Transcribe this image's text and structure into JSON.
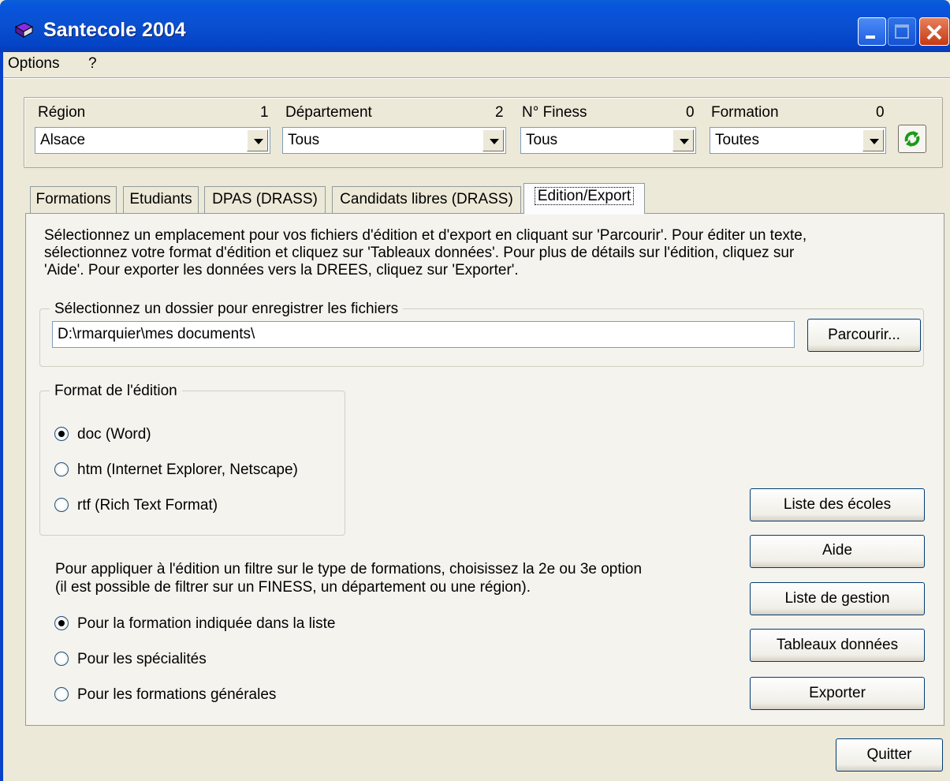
{
  "window": {
    "title": "Santecole 2004"
  },
  "menu": {
    "items": [
      "Options",
      "?"
    ]
  },
  "filters": {
    "region": {
      "label": "Région",
      "count": "1",
      "value": "Alsace"
    },
    "departement": {
      "label": "Département",
      "count": "2",
      "value": "Tous"
    },
    "finess": {
      "label": "N° Finess",
      "count": "0",
      "value": "Tous"
    },
    "formation": {
      "label": "Formation",
      "count": "0",
      "value": "Toutes"
    }
  },
  "tabs": [
    {
      "label": "Formations"
    },
    {
      "label": "Etudiants"
    },
    {
      "label": "DPAS (DRASS)"
    },
    {
      "label": "Candidats libres (DRASS)"
    },
    {
      "label": "Edition/Export"
    }
  ],
  "edition": {
    "description": [
      "Sélectionnez un emplacement pour vos fichiers d'édition et d'export en cliquant sur 'Parcourir'. Pour éditer un texte,",
      "sélectionnez votre format d'édition et cliquez sur 'Tableaux données'. Pour plus de détails sur l'édition, cliquez sur",
      "'Aide'. Pour exporter les données vers la DREES, cliquez sur 'Exporter'."
    ],
    "folder_group_label": "Sélectionnez un dossier pour enregistrer les fichiers",
    "folder_path": "D:\\rmarquier\\mes documents\\",
    "browse_label": "Parcourir...",
    "format_group_label": "Format de l'édition",
    "formats": [
      {
        "label": "doc (Word)",
        "checked": true
      },
      {
        "label": "htm (Internet Explorer, Netscape)",
        "checked": false
      },
      {
        "label": "rtf (Rich Text Format)",
        "checked": false
      }
    ],
    "filter_text": [
      "Pour appliquer à l'édition un filtre sur le type de formations, choisissez la 2e ou 3e option",
      "(il est possible de filtrer sur un FINESS, un département ou une région)."
    ],
    "filter_options": [
      {
        "label": "Pour la formation indiquée dans la liste",
        "checked": true
      },
      {
        "label": "Pour les spécialités",
        "checked": false
      },
      {
        "label": "Pour les formations générales",
        "checked": false
      }
    ],
    "buttons": {
      "liste_ecoles": "Liste des écoles",
      "aide": "Aide",
      "liste_gestion": "Liste de gestion",
      "tableaux": "Tableaux données",
      "exporter": "Exporter"
    }
  },
  "quit_label": "Quitter"
}
